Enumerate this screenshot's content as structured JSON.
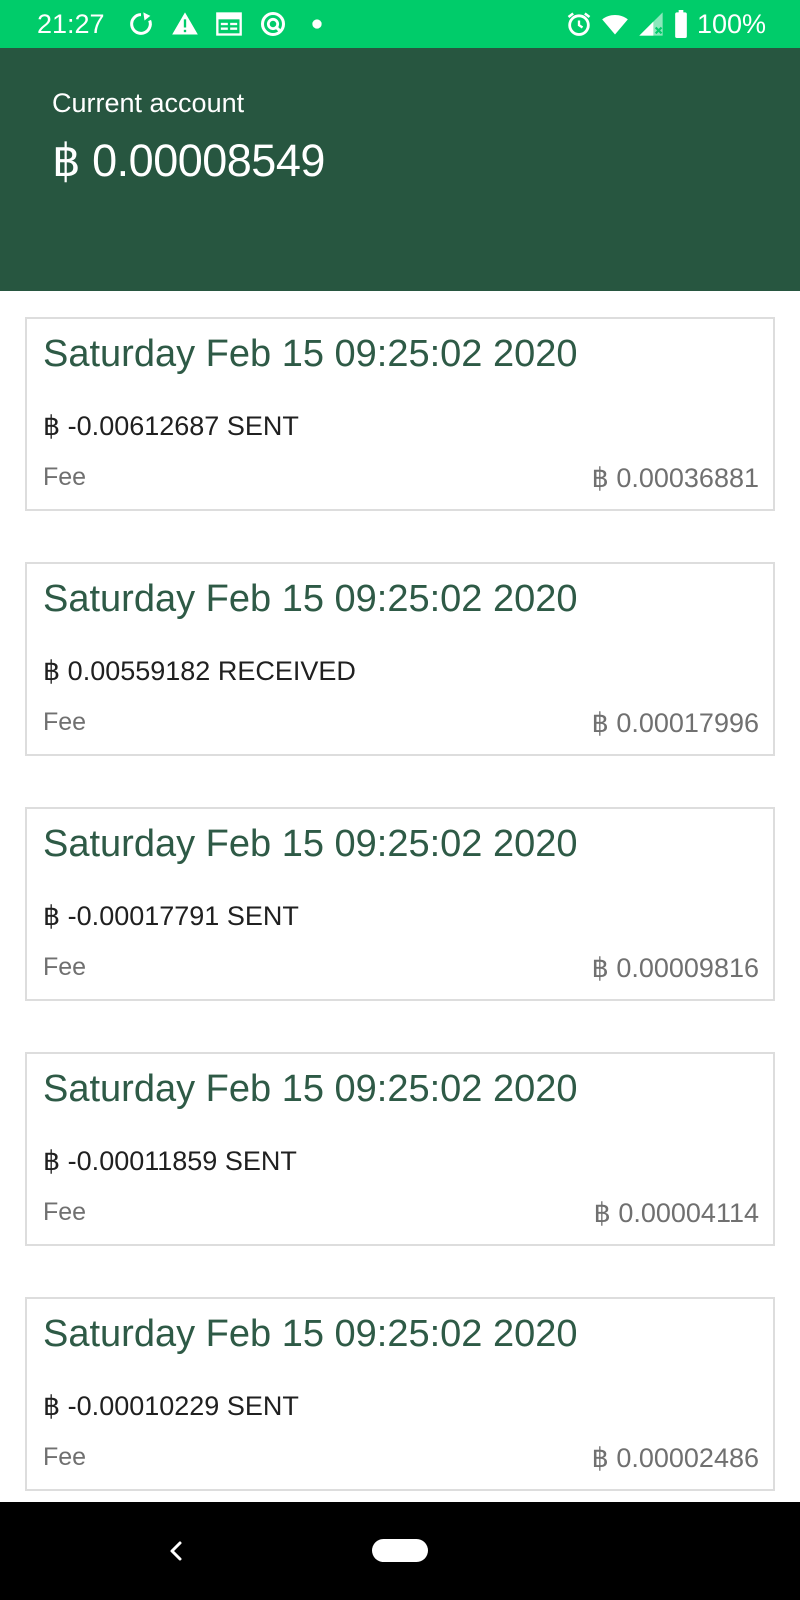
{
  "status_bar": {
    "time": "21:27",
    "battery": "100%",
    "icons_left": [
      "sync-icon",
      "warning-icon",
      "calendar-icon",
      "data-saver-icon",
      "notification-dot-icon"
    ],
    "icons_right": [
      "alarm-icon",
      "wifi-icon",
      "signal-icon",
      "battery-icon"
    ]
  },
  "header": {
    "label": "Current account",
    "balance": "฿ 0.00008549"
  },
  "transactions": [
    {
      "date": "Saturday Feb 15 09:25:02 2020",
      "amount": "฿ -0.00612687 SENT",
      "fee_label": "Fee",
      "fee": "฿ 0.00036881"
    },
    {
      "date": "Saturday Feb 15 09:25:02 2020",
      "amount": "฿ 0.00559182 RECEIVED",
      "fee_label": "Fee",
      "fee": "฿ 0.00017996"
    },
    {
      "date": "Saturday Feb 15 09:25:02 2020",
      "amount": "฿ -0.00017791 SENT",
      "fee_label": "Fee",
      "fee": "฿ 0.00009816"
    },
    {
      "date": "Saturday Feb 15 09:25:02 2020",
      "amount": "฿ -0.00011859 SENT",
      "fee_label": "Fee",
      "fee": "฿ 0.00004114"
    },
    {
      "date": "Saturday Feb 15 09:25:02 2020",
      "amount": "฿ -0.00010229 SENT",
      "fee_label": "Fee",
      "fee": "฿ 0.00002486"
    }
  ],
  "colors": {
    "status_bar": "#00cc6a",
    "header": "#275640",
    "date_text": "#2e5a46",
    "nav_bar": "#000000"
  }
}
